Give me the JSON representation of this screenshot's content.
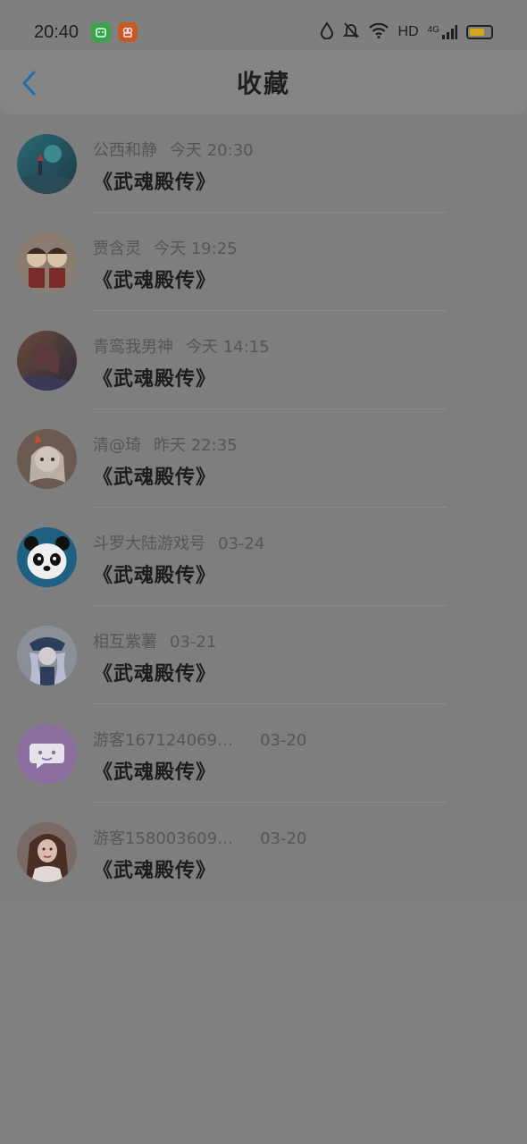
{
  "status_bar": {
    "time": "20:40",
    "hd": "HD",
    "net": "4G",
    "icons": [
      "water-drop-icon",
      "mute-bell-icon",
      "wifi-icon",
      "signal-icon",
      "battery-icon"
    ],
    "battery_color": "#d6a619"
  },
  "header": {
    "title": "收藏",
    "back_icon": "chevron-left-icon",
    "accent": "#1c6fb0"
  },
  "favorites": [
    {
      "user": "公西和静",
      "time": "今天 20:30",
      "title": "《武魂殿传》",
      "avatar_color": "#2f5f6a"
    },
    {
      "user": "贾含灵",
      "time": "今天 19:25",
      "title": "《武魂殿传》",
      "avatar_color": "#6a5a4a"
    },
    {
      "user": "青鸾我男神",
      "time": "今天 14:15",
      "title": "《武魂殿传》",
      "avatar_color": "#4a4040"
    },
    {
      "user": "清@琦",
      "time": "昨天 22:35",
      "title": "《武魂殿传》",
      "avatar_color": "#8a7060"
    },
    {
      "user": "斗罗大陆游戏号",
      "time": "03-24",
      "title": "《武魂殿传》",
      "avatar_color": "#1f5f80"
    },
    {
      "user": "相互紫薯",
      "time": "03-21",
      "title": "《武魂殿传》",
      "avatar_color": "#2c3e5c"
    },
    {
      "user": "游客167124069…",
      "time": "03-20",
      "title": "《武魂殿传》",
      "avatar_color": "#8a6ea0"
    },
    {
      "user": "游客158003609…",
      "time": "03-20",
      "title": "《武魂殿传》",
      "avatar_color": "#5a4038"
    }
  ]
}
